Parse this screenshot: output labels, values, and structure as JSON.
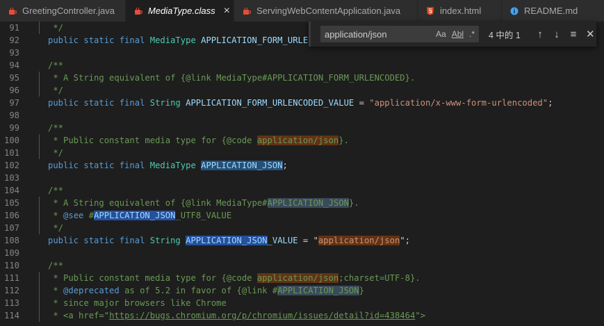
{
  "tabs": [
    {
      "label": "GreetingController.java",
      "icon": "java-cup-icon",
      "active": false
    },
    {
      "label": "MediaType.class",
      "icon": "java-cup-icon",
      "active": true
    },
    {
      "label": "ServingWebContentApplication.java",
      "icon": "java-cup-icon",
      "active": false
    },
    {
      "label": "index.html",
      "icon": "html5-icon",
      "active": false
    },
    {
      "label": "README.md",
      "icon": "info-icon",
      "active": false
    }
  ],
  "find": {
    "query": "application/json",
    "opt_case": "Aa",
    "opt_word": "Abl",
    "opt_regex": ".*",
    "count": "4 中的 1"
  },
  "lines": [
    {
      "n": "91"
    },
    {
      "n": "92"
    },
    {
      "n": "93"
    },
    {
      "n": "94"
    },
    {
      "n": "95"
    },
    {
      "n": "96"
    },
    {
      "n": "97"
    },
    {
      "n": "98"
    },
    {
      "n": "99"
    },
    {
      "n": "100"
    },
    {
      "n": "101"
    },
    {
      "n": "102"
    },
    {
      "n": "103"
    },
    {
      "n": "104"
    },
    {
      "n": "105"
    },
    {
      "n": "106"
    },
    {
      "n": "107"
    },
    {
      "n": "108"
    },
    {
      "n": "109"
    },
    {
      "n": "110"
    },
    {
      "n": "111"
    },
    {
      "n": "112"
    },
    {
      "n": "113"
    },
    {
      "n": "114"
    }
  ],
  "code": {
    "l91": " */",
    "l92_kw": "public static final ",
    "l92_ty": "MediaType ",
    "l92_id": "APPLICATION_FORM_URLENCODED;",
    "l94": "/**",
    "l95": " * A String equivalent of {@link MediaType#APPLICATION_FORM_URLENCODED}.",
    "l96": " */",
    "l97_kw": "public static final ",
    "l97_ty": "String ",
    "l97_id": "APPLICATION_FORM_URLENCODED_VALUE",
    "l97_eq": " = ",
    "l97_str": "\"application/x-www-form-urlencoded\"",
    "l97_end": ";",
    "l99": "/**",
    "l100_a": " * Public constant media type for {@code ",
    "l100_hl": "application/json",
    "l100_b": "}.",
    "l101": " */",
    "l102_kw": "public static final ",
    "l102_ty": "MediaType ",
    "l102_id": "APPLICATION_JSON",
    "l102_end": ";",
    "l104": "/**",
    "l105_a": " * A String equivalent of {@link MediaType#",
    "l105_hl": "APPLICATION_JSON",
    "l105_b": "}.",
    "l106_a": " * ",
    "l106_tag": "@see",
    "l106_b": " #",
    "l106_hl": "APPLICATION_JSON",
    "l106_c": "_UTF8_VALUE",
    "l107": " */",
    "l108_kw": "public static final ",
    "l108_ty": "String ",
    "l108_id": "APPLICATION_JSON",
    "l108_id2": "_VALUE",
    "l108_eq": " = \"",
    "l108_str": "application/json",
    "l108_end": "\";",
    "l110": "/**",
    "l111_a": " * Public constant media type for {@code ",
    "l111_hl": "application/json",
    "l111_b": ";charset=UTF-8}.",
    "l112_a": " * ",
    "l112_tag": "@deprecated",
    "l112_b": " as of 5.2 in favor of {@link #",
    "l112_hl": "APPLICATION_JSON",
    "l112_c": "}",
    "l113": " * since major browsers like Chrome",
    "l114_a": " * <a href=\"",
    "l114_link": "https://bugs.chromium.org/p/chromium/issues/detail?id=438464",
    "l114_b": "\">"
  }
}
